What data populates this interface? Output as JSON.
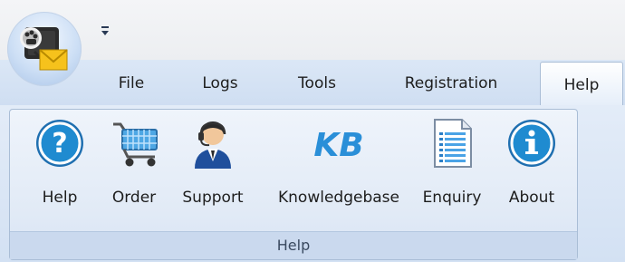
{
  "tabs": {
    "file": "File",
    "logs": "Logs",
    "tools": "Tools",
    "registration": "Registration",
    "help": "Help"
  },
  "ribbon": {
    "group_label": "Help",
    "buttons": [
      {
        "label": "Help",
        "icon": "help-question-icon"
      },
      {
        "label": "Order",
        "icon": "shopping-cart-icon"
      },
      {
        "label": "Support",
        "icon": "support-agent-icon"
      },
      {
        "label": "Knowledgebase",
        "icon": "kb-logo-icon"
      },
      {
        "label": "Enquiry",
        "icon": "document-icon"
      },
      {
        "label": "About",
        "icon": "info-icon"
      }
    ]
  },
  "qat": {
    "icon": "qat-dropdown-icon"
  },
  "app": {
    "icon": "app-logo-icon"
  },
  "colors": {
    "help_blue": "#1f8bd0",
    "tab_bar": "#cfdef2",
    "group_footer": "#cad9ee"
  }
}
